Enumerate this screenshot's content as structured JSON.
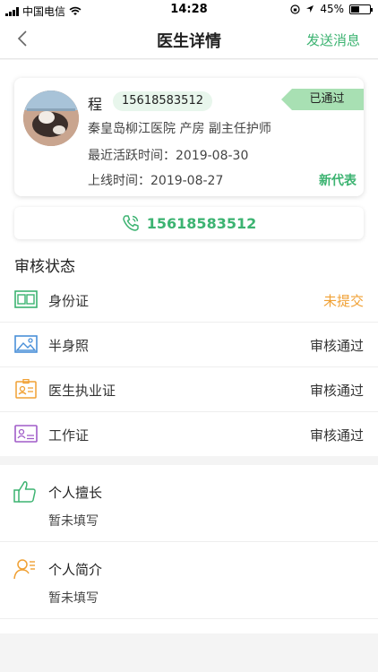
{
  "status_bar": {
    "carrier": "中国电信",
    "time": "14:28",
    "battery": "45%",
    "battery_level": 0.45
  },
  "nav": {
    "title": "医生详情",
    "action": "发送消息"
  },
  "profile": {
    "name": "程",
    "phone": "15618583512",
    "status": "已通过",
    "hospital_line": "秦皇岛柳江医院  产房  副主任护师",
    "last_active": "最近活跃时间：2019-08-30",
    "online_time": "上线时间：2019-08-27",
    "tag": "新代表"
  },
  "call": {
    "phone": "15618583512"
  },
  "review": {
    "title": "审核状态",
    "items": [
      {
        "label": "身份证",
        "status": "未提交",
        "icon": "id-card-icon",
        "color": "#3cb371"
      },
      {
        "label": "半身照",
        "status": "审核通过",
        "icon": "photo-icon",
        "color": "#4a90d9"
      },
      {
        "label": "医生执业证",
        "status": "审核通过",
        "icon": "badge-icon",
        "color": "#f0a033"
      },
      {
        "label": "工作证",
        "status": "审核通过",
        "icon": "work-card-icon",
        "color": "#a05cc8"
      }
    ]
  },
  "details": [
    {
      "label": "个人擅长",
      "value": "暂未填写",
      "icon": "thumbs-up-icon"
    },
    {
      "label": "个人简介",
      "value": "暂未填写",
      "icon": "person-profile-icon"
    }
  ],
  "colors": {
    "accent": "#3cb371",
    "pending": "#f0a033"
  }
}
